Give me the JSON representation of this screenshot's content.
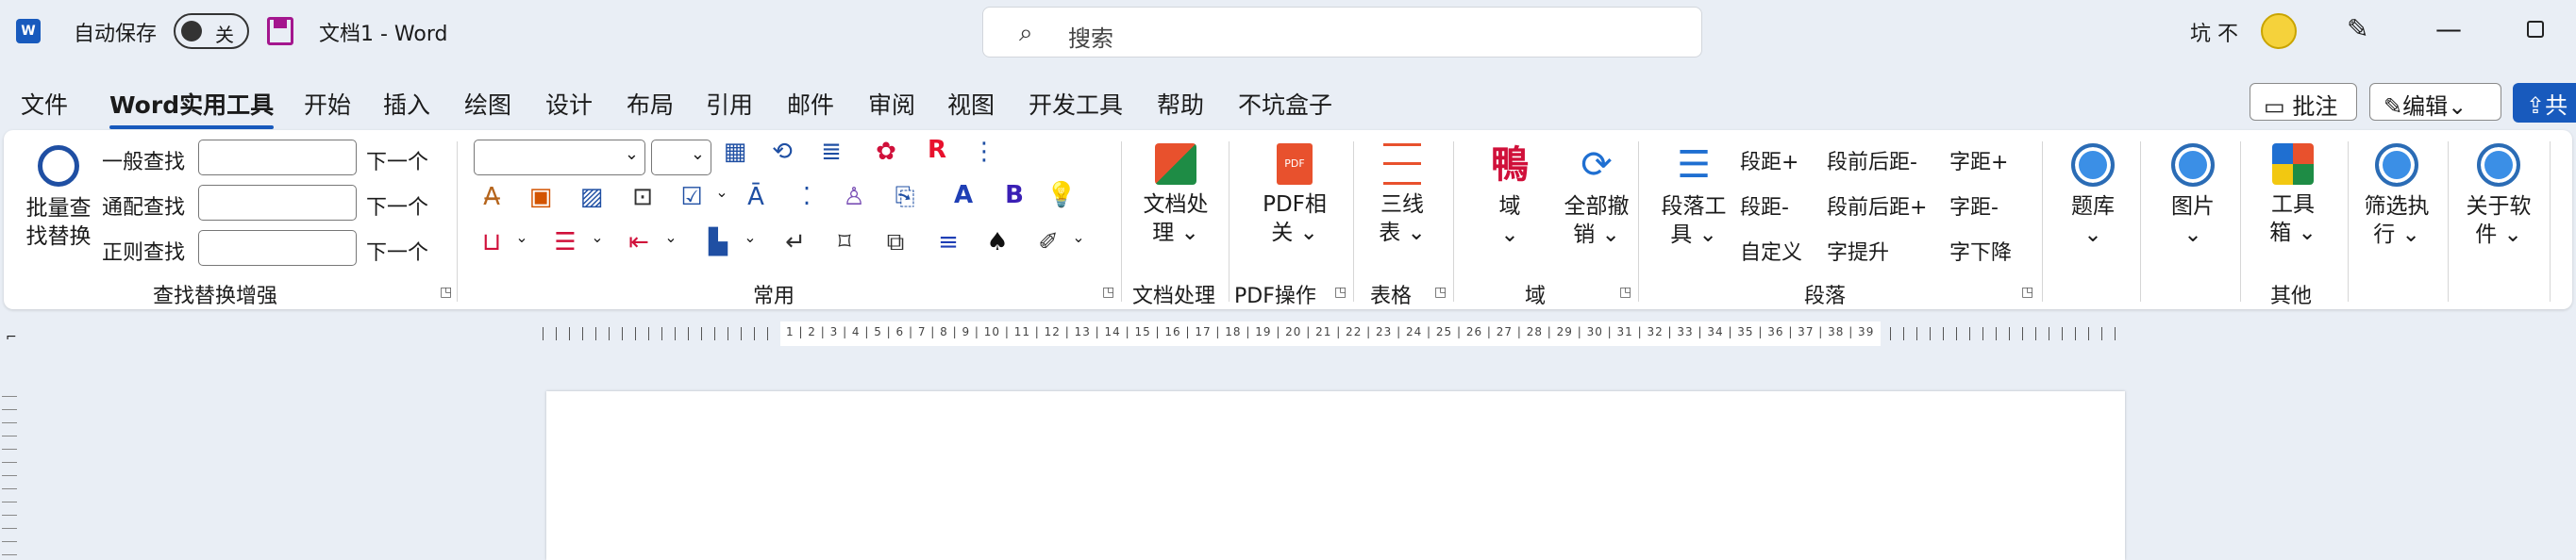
{
  "titlebar": {
    "app_icon": "word-logo-icon",
    "autosave_label": "自动保存",
    "autosave_state": "关",
    "doc_title": "文档1  -  Word",
    "search_placeholder": "搜索",
    "user_name": "坑 不"
  },
  "tabs": [
    "文件",
    "Word实用工具",
    "开始",
    "插入",
    "绘图",
    "设计",
    "布局",
    "引用",
    "邮件",
    "审阅",
    "视图",
    "开发工具",
    "帮助",
    "不坑盒子"
  ],
  "active_tab": "Word实用工具",
  "tab_right": {
    "comments": "批注",
    "editing": "编辑",
    "share": "共"
  },
  "find_group": {
    "big_button_l1": "批量查",
    "big_button_l2": "找替换",
    "rows": [
      {
        "label": "一般查找",
        "next": "下一个"
      },
      {
        "label": "通配查找",
        "next": "下一个"
      },
      {
        "label": "正则查找",
        "next": "下一个"
      }
    ],
    "group_label": "查找替换增强"
  },
  "common_group": {
    "group_label": "常用"
  },
  "doc_group": {
    "btn_l1": "文档处",
    "btn_l2": "理",
    "group_label": "文档处理"
  },
  "pdf_group": {
    "btn_l1": "PDF相",
    "btn_l2": "关",
    "group_label": "PDF操作"
  },
  "table_group": {
    "btn_l1": "三线",
    "btn_l2": "表",
    "group_label": "表格"
  },
  "field_group": {
    "btn1": "域",
    "btn2_l1": "全部撤",
    "btn2_l2": "销",
    "group_label": "域"
  },
  "para_group": {
    "btn_l1": "段落工",
    "btn_l2": "具",
    "col1": [
      "段距+",
      "段距-",
      "自定义"
    ],
    "col2": [
      "段前后距-",
      "段前后距+",
      "字提升"
    ],
    "col3": [
      "字距+",
      "字距-",
      "字下降"
    ],
    "group_label": "段落"
  },
  "right_buttons": [
    {
      "l1": "题库",
      "l2": ""
    },
    {
      "l1": "图片",
      "l2": ""
    },
    {
      "l1": "工具",
      "l2": "箱"
    },
    {
      "l1": "筛选执",
      "l2": "行"
    },
    {
      "l1": "关于软",
      "l2": "件"
    }
  ],
  "other_group_label": "其他",
  "ruler_numbers": "1 | 2 | 3 | 4 | 5 | 6 | 7 | 8 | 9 | 10 | 11 | 12 | 13 | 14 | 15 | 16 | 17 | 18 | 19 | 20 | 21 | 22 | 23 | 24 | 25 | 26 | 27 | 28 | 29 | 30 | 31 | 32 | 33 | 34 | 35 | 36 | 37 | 38 | 39",
  "colors": {
    "accent": "#185abd",
    "save_icon": "#a4168e",
    "circle_icon": "#3b8fe6"
  }
}
